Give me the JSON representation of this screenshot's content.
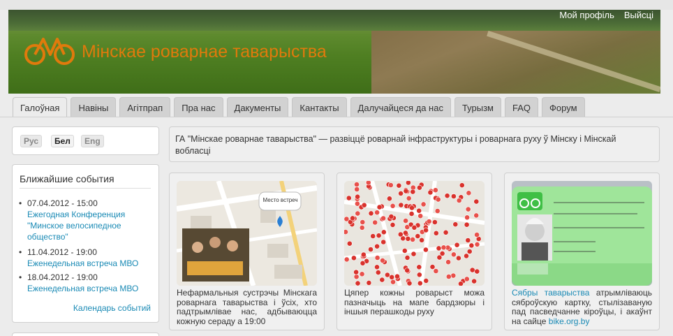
{
  "site": {
    "title": "Мінскае роварнае таварыства"
  },
  "user_links": {
    "profile": "Мой профіль",
    "logout": "Выйсці"
  },
  "nav": {
    "tabs": [
      "Галоўная",
      "Навіны",
      "Агітпрап",
      "Пра нас",
      "Дакументы",
      "Кантакты",
      "Далучайцеся да нас",
      "Турызм",
      "FAQ",
      "Форум"
    ],
    "active_index": 0
  },
  "languages": {
    "items": [
      "Рус",
      "Бел",
      "Eng"
    ],
    "active_index": 1
  },
  "events": {
    "title": "Ближайшие события",
    "items": [
      {
        "date": "07.04.2012 - 15:00",
        "title": "Ежегодная Конференция \"Минское велосипедное общество\""
      },
      {
        "date": "11.04.2012 - 19:00",
        "title": "Еженедельная встреча МВО"
      },
      {
        "date": "18.04.2012 - 19:00",
        "title": "Еженедельная встреча МВО"
      }
    ],
    "calendar_link": "Календарь событий"
  },
  "intro": {
    "text": "ГА \"Мінскае роварнае таварыства\" — развіццё роварнай інфраструктуры і роварнага руху ў Мінску і Мінскай вобласці"
  },
  "cards": [
    {
      "image": "meeting-map-photo",
      "map_popup": "Место встреч",
      "text": "Нефармальныя сустрэчы Мінскага роварнага таварыства і ўсіх, хто падтрымлівае нас, адбываюцца кожную сераду а 19:00"
    },
    {
      "image": "obstacles-map",
      "text": "Цяпер кожны роварыст можа пазначыць на мапе бардзюры і іншыя перашкоды руху"
    },
    {
      "image": "member-id-card",
      "link_text": "Сябры таварыства",
      "text": " атрымліваюць сяброўскую картку, стылізаваную пад пасведчанне кіроўцы, і акаўнт на сайце ",
      "link2": "bike.org.by"
    }
  ],
  "colors": {
    "accent": "#e07a0c",
    "link": "#1a8ab5"
  }
}
